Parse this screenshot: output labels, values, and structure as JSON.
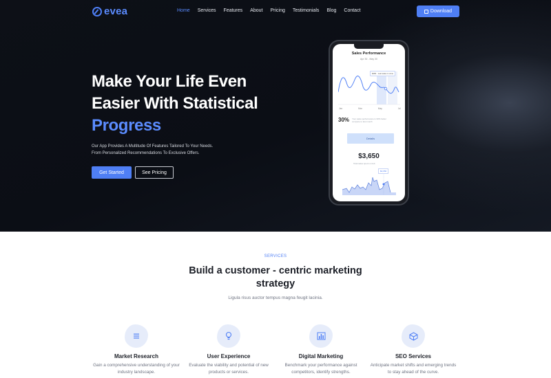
{
  "nav": {
    "brand": "evea",
    "links": [
      "Home",
      "Services",
      "Features",
      "About",
      "Pricing",
      "Testimonials",
      "Blog",
      "Contact"
    ],
    "active": "Home",
    "download_label": "Download"
  },
  "hero": {
    "title_line1": "Make Your Life Even",
    "title_line2": "Easier With Statistical",
    "title_highlight": "Progress",
    "desc_line1": "Our App Provides A Multitude Of Features Tailored To Your Needs.",
    "desc_line2": "From Personalized Recommendations To Exclusive Offers.",
    "cta_primary": "Get Started",
    "cta_secondary": "See Pricing"
  },
  "phone": {
    "title": "Sales Performance",
    "date_range": "Apr 30 - May 30",
    "tooltip": "$280 · Last sales in June",
    "months": [
      "Jan",
      "Mar",
      "May",
      "Jul"
    ],
    "percent": "30%",
    "percent_desc": "Your sales performance is 30% better compare to last month",
    "details_label": "Details",
    "amount": "$3,650",
    "amount_desc": "Total sales spent on feb",
    "tooltip2": "$3,650"
  },
  "services": {
    "eyebrow": "SERVICES",
    "title": "Build a customer - centric marketing strategy",
    "subtitle": "Ligula risus auctor tempus magna feugit lacinia.",
    "items": [
      {
        "name": "Market Research",
        "desc": "Gain a comprehensive understanding of your industry landscape.",
        "icon": "list-icon"
      },
      {
        "name": "User Experience",
        "desc": "Evaluate the viability and potential of new products or services.",
        "icon": "lightbulb-icon"
      },
      {
        "name": "Digital Marketing",
        "desc": "Benchmark your performance against competitors, identify strengths.",
        "icon": "bar-chart-icon"
      },
      {
        "name": "SEO Services",
        "desc": "Anticipate market shifts and emerging trends to stay ahead of the curve.",
        "icon": "cube-icon"
      }
    ]
  },
  "colors": {
    "accent": "#4f7ff5",
    "hero_bg": "#0d1017"
  }
}
